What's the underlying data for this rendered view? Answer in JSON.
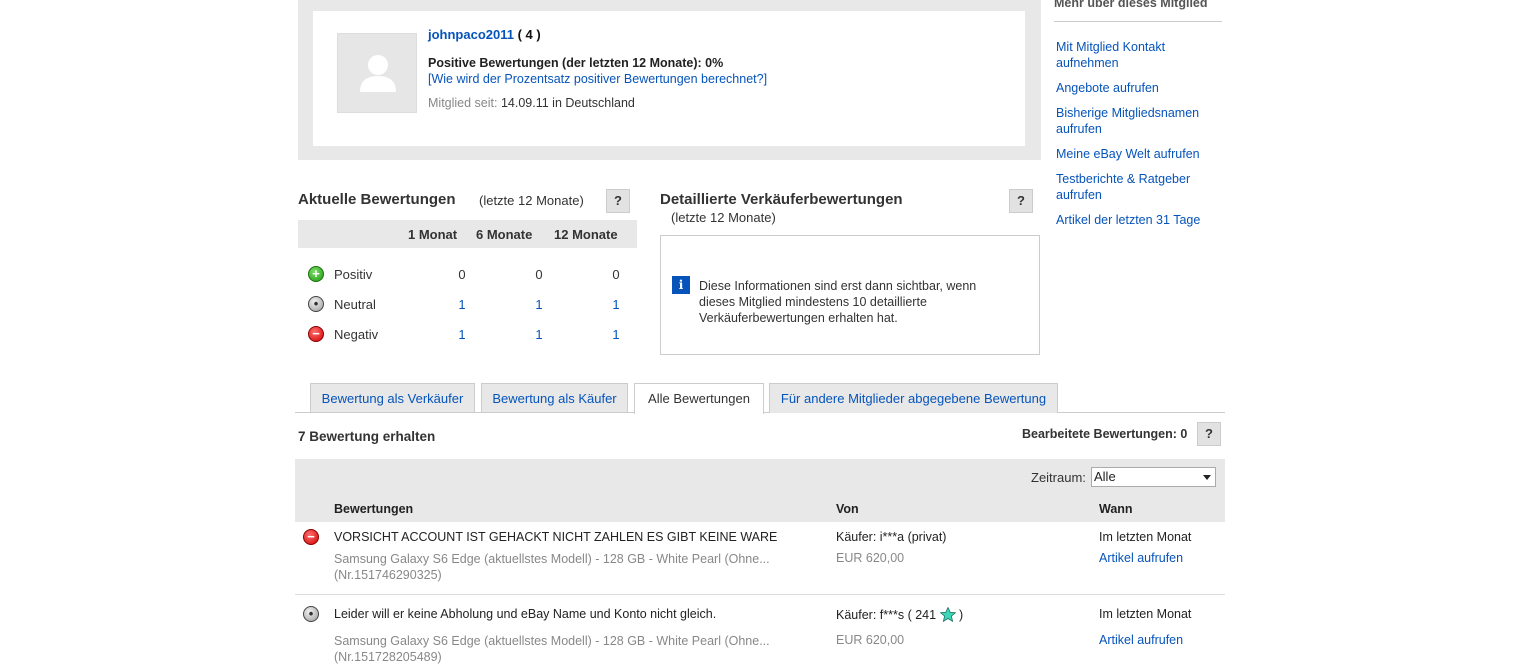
{
  "profile": {
    "username": "johnpaco2011",
    "score": "( 4 )",
    "positive_line": "Positive Bewertungen (der letzten 12 Monate): 0%",
    "how_link": "[Wie wird der Prozentsatz positiver Bewertungen berechnet?]",
    "member_since_label": "Mitglied seit:",
    "member_since_value": "14.09.11 in Deutschland"
  },
  "sidebar": {
    "title": "Mehr über dieses Mitglied",
    "items": [
      {
        "label": "Mit Mitglied Kontakt aufnehmen"
      },
      {
        "label": "Angebote aufrufen"
      },
      {
        "label": "Bisherige Mitgliedsnamen aufrufen"
      },
      {
        "label": "Meine eBay Welt aufrufen"
      },
      {
        "label": "Testberichte & Ratgeber aufrufen"
      },
      {
        "label": "Artikel der letzten 31 Tage"
      }
    ]
  },
  "current_feedback": {
    "title": "Aktuelle Bewertungen",
    "subtitle": "(letzte 12 Monate)",
    "help": "?",
    "columns": [
      "1 Monat",
      "6 Monate",
      "12 Monate"
    ],
    "rows": [
      {
        "label": "Positiv",
        "values": [
          "0",
          "0",
          "0"
        ],
        "icon": "positive-icon"
      },
      {
        "label": "Neutral",
        "values": [
          "1",
          "1",
          "1"
        ],
        "icon": "neutral-icon"
      },
      {
        "label": "Negativ",
        "values": [
          "1",
          "1",
          "1"
        ],
        "icon": "negative-icon"
      }
    ]
  },
  "detailed": {
    "title": "Detaillierte Verkäuferbewertungen",
    "subtitle": "(letzte 12 Monate)",
    "help": "?",
    "info_icon": "i",
    "info_text": "Diese Informationen sind erst dann sichtbar, wenn dieses Mitglied mindestens 10 detaillierte Verkäuferbewertungen erhalten hat."
  },
  "tabs": [
    {
      "label": "Bewertung als Verkäufer"
    },
    {
      "label": "Bewertung als Käufer"
    },
    {
      "label": "Alle Bewertungen"
    },
    {
      "label": "Für andere Mitglieder abgegebene Bewertung"
    }
  ],
  "summary": {
    "received": "7 Bewertung erhalten",
    "edited": "Bearbeitete Bewertungen: 0",
    "help": "?"
  },
  "list": {
    "zeitraum_label": "Zeitraum:",
    "zeitraum_value": "Alle",
    "col_bewertungen": "Bewertungen",
    "col_von": "Von",
    "col_wann": "Wann",
    "rows": [
      {
        "type": "negative",
        "text": "VORSICHT ACCOUNT IST GEHACKT NICHT ZAHLEN ES GIBT KEINE WARE",
        "item": "Samsung Galaxy S6 Edge (aktuellstes Modell) - 128 GB - White Pearl (Ohne...",
        "item_nr": "(Nr.151746290325)",
        "von": "Käufer: i***a (privat)",
        "price": "EUR 620,00",
        "wann": "Im letzten Monat",
        "link": "Artikel aufrufen"
      },
      {
        "type": "neutral",
        "text": "Leider will er keine Abholung und eBay Name und Konto nicht gleich.",
        "item": "Samsung Galaxy S6 Edge (aktuellstes Modell) - 128 GB - White Pearl (Ohne...",
        "item_nr": "(Nr.151728205489)",
        "von_prefix": "Käufer: f***s ( 241",
        "von_suffix": ")",
        "price": "EUR 620,00",
        "wann": "Im letzten Monat",
        "link": "Artikel aufrufen"
      }
    ]
  }
}
